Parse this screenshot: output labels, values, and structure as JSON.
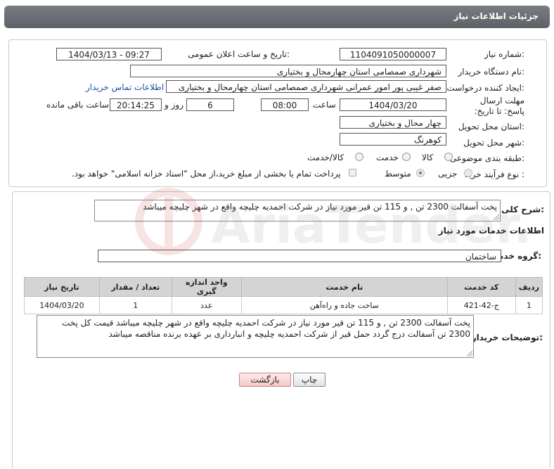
{
  "header": {
    "title": "جزئیات اطلاعات نیاز"
  },
  "form": {
    "need_number": {
      "label": "شماره نیاز:",
      "value": "1104091050000007"
    },
    "announce_datetime": {
      "label": "تاریخ و ساعت اعلان عمومی:",
      "value": "1404/03/13 - 09:27"
    },
    "buyer_org": {
      "label": "نام دستگاه خریدار:",
      "value": "شهرداری صمصامی استان چهارمحال و بختیاری"
    },
    "requester": {
      "label": "ایجاد کننده درخواست:",
      "value": "صفر غیبی پور امور عمرانی شهرداری صمصامی استان چهارمحال و بختیاری",
      "contact_link": "اطلاعات تماس خریدار"
    },
    "deadline": {
      "label": "مهلت ارسال پاسخ: تا تاریخ:",
      "date": "1404/03/20",
      "time_label": "ساعت",
      "time": "08:00",
      "days": "6",
      "days_label": "روز و",
      "remaining": "20:14:25",
      "remaining_label": "ساعت باقی مانده"
    },
    "province": {
      "label": "استان محل تحویل:",
      "value": "چهار محال و بختیاری"
    },
    "city": {
      "label": "شهر محل تحویل:",
      "value": "کوهرنگ"
    },
    "category": {
      "label": "طبقه بندی موضوعی:",
      "options": [
        "کالا",
        "خدمت",
        "کالا/خدمت"
      ]
    },
    "process": {
      "label": "نوع فرآیند خرید :",
      "options": [
        "جزیی",
        "متوسط"
      ],
      "payment_note": "پرداخت تمام یا بخشی از مبلغ خرید،از محل \"اسناد خزانه اسلامی\" خواهد بود."
    }
  },
  "summary": {
    "label": "شرح کلی نیاز:",
    "text": "پخت آسفالت 2300 تن ,  و 115 تن قیر مورد نیاز در  شرکت احمدیه چلیچه  واقع در شهر چلیچه  میباشد"
  },
  "services": {
    "section_title": "اطلاعات خدمات مورد نیاز",
    "group_label": "گروه خدمت:",
    "group_value": "ساختمان",
    "columns": [
      "ردیف",
      "کد خدمت",
      "نام خدمت",
      "واحد اندازه گیری",
      "تعداد / مقدار",
      "تاریخ نیاز"
    ],
    "rows": [
      [
        "1",
        "ج-42-421",
        "ساخت جاده و راه‌آهن",
        "عدد",
        "1",
        "1404/03/20"
      ]
    ]
  },
  "buyer_notes": {
    "label": "توضیحات خریدار:",
    "text": "پخت آسفالت 2300 تن ,  و 115 تن قیر مورد نیاز در  شرکت احمدیه چلیچه  واقع در شهر چلیچه  میباشد قیمت کل پخت 2300 تن آسفالت درج گردد حمل قیر از شرکت احمدیه چلیچه و انبارداری بر عهده برنده مناقصه میباشد"
  },
  "actions": {
    "print": "چاپ",
    "back": "بازگشت"
  },
  "watermark": {
    "text": "AriaTender.neT"
  },
  "colors": {
    "header_bg": "#6b6f75",
    "link": "#1a4fa0",
    "back_button": "#f4c8c8"
  }
}
